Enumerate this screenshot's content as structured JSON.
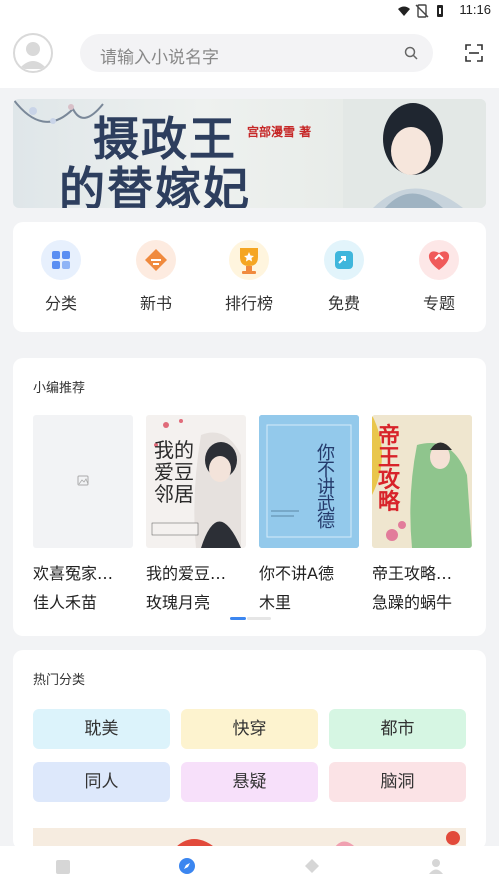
{
  "status_bar": {
    "time": "11:16"
  },
  "header": {
    "search_placeholder": "请输入小说名字"
  },
  "banner": {
    "title_line1": "摄政王",
    "title_line2": "的替嫁妃",
    "seal_text": "宫部漫雪 著"
  },
  "nav": {
    "items": [
      {
        "label": "分类",
        "icon": "category-icon",
        "color": "#e7f0fd"
      },
      {
        "label": "新书",
        "icon": "new-book-icon",
        "color": "#fdebe0"
      },
      {
        "label": "排行榜",
        "icon": "trophy-icon",
        "color": "#fff5de"
      },
      {
        "label": "免费",
        "icon": "free-icon",
        "color": "#e2f4fb"
      },
      {
        "label": "专题",
        "icon": "topic-icon",
        "color": "#fde7e7"
      }
    ]
  },
  "recommend": {
    "title": "小编推荐",
    "books": [
      {
        "title": "欢喜冤家…",
        "author": "佳人禾苗"
      },
      {
        "title": "我的爱豆…",
        "author": "玫瑰月亮"
      },
      {
        "title": "你不讲A德",
        "author": "木里"
      },
      {
        "title": "帝王攻略…",
        "author": "急躁的蜗牛"
      }
    ],
    "covers": {
      "book2_title": "我的爱豆邻居",
      "book3_title": "你不讲武德",
      "book4_title": "帝王攻略"
    }
  },
  "hot_categories": {
    "title": "热门分类",
    "tags": [
      {
        "label": "耽美",
        "color": "#dcf3fb"
      },
      {
        "label": "快穿",
        "color": "#fdf3cf"
      },
      {
        "label": "都市",
        "color": "#d6f6e3"
      },
      {
        "label": "同人",
        "color": "#dde8fb"
      },
      {
        "label": "悬疑",
        "color": "#f7e0fa"
      },
      {
        "label": "脑洞",
        "color": "#fbe3e6"
      }
    ]
  },
  "tabbar": {
    "tabs": [
      {
        "icon": "bookshelf-icon"
      },
      {
        "icon": "discover-icon",
        "active": true
      },
      {
        "icon": "category-tab-icon"
      },
      {
        "icon": "profile-icon"
      }
    ]
  },
  "colors": {
    "accent": "#3b86f0"
  }
}
